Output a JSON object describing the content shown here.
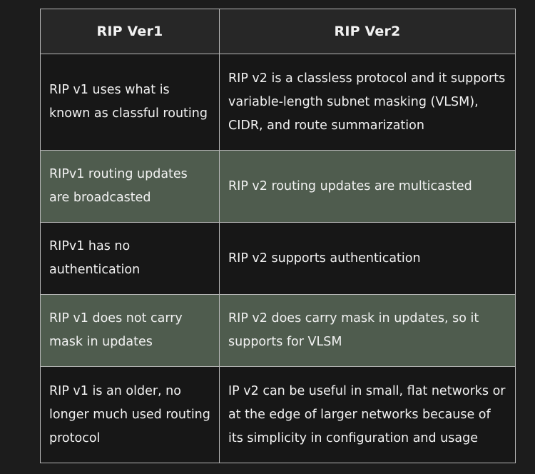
{
  "table": {
    "headers": [
      "RIP Ver1",
      "RIP Ver2"
    ],
    "rows": [
      [
        "RIP v1 uses what is known as classful routing",
        "RIP v2 is a classless protocol and it supports variable-length subnet masking (VLSM), CIDR, and route summarization"
      ],
      [
        "RIPv1 routing updates are broadcasted",
        "RIP v2 routing updates are multicasted"
      ],
      [
        "RIPv1 has no authentication",
        "RIP v2 supports authentication"
      ],
      [
        "RIP v1 does not carry mask in updates",
        "RIP v2 does carry mask in updates, so it supports for VLSM"
      ],
      [
        "RIP v1 is an older, no longer much used routing protocol",
        "IP v2 can be useful in small, flat networks or at the edge of larger networks because of its simplicity in configuration and usage"
      ]
    ]
  },
  "colors": {
    "page_background": "#1c1c1c",
    "header_background": "#272727",
    "dark_row": "#171717",
    "green_row": "#4f5c4e",
    "border": "#b7b7b7",
    "text": "#f2f2f2"
  }
}
